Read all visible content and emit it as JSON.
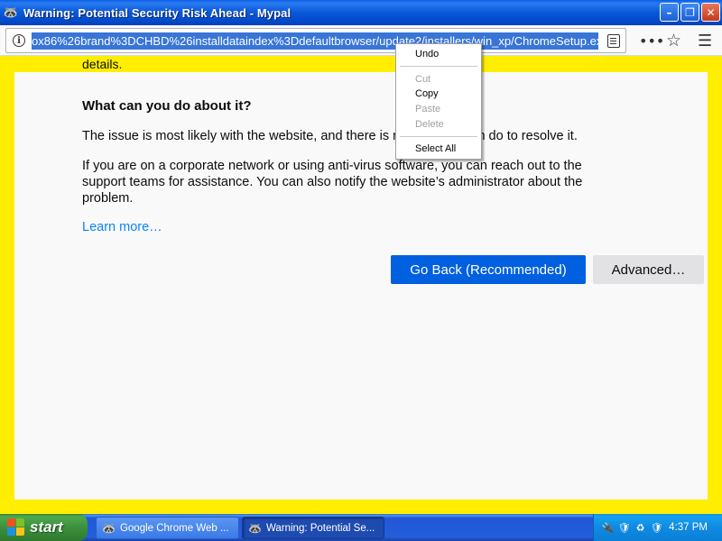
{
  "window": {
    "title": "Warning: Potential Security Risk Ahead - Mypal",
    "minimize_glyph": "–",
    "maximize_glyph": "❐",
    "close_glyph": "✕"
  },
  "toolbar": {
    "url": "ox86%26brand%3DCHBD%26installdataindex%3Ddefaultbrowser/update2/installers/win_xp/ChromeSetup.exe",
    "more_glyph": "•••",
    "star_glyph": "☆",
    "menu_glyph": "☰"
  },
  "page": {
    "top_peek": "details.",
    "heading": "What can you do about it?",
    "paragraph1": "The issue is most likely with the website, and there is nothing you can do to resolve it.",
    "paragraph2": "If you are on a corporate network or using anti-virus software, you can reach out to the support teams for assistance. You can also notify the website’s administrator about the problem.",
    "learn_more": "Learn more…",
    "go_back_button": "Go Back (Recommended)",
    "advanced_button": "Advanced…"
  },
  "context_menu": {
    "undo": "Undo",
    "cut": "Cut",
    "copy": "Copy",
    "paste": "Paste",
    "delete": "Delete",
    "select_all": "Select All"
  },
  "taskbar": {
    "start_label": "start",
    "tasks": [
      {
        "label": "Google Chrome Web ..."
      },
      {
        "label": "Warning: Potential Se..."
      }
    ],
    "clock": "4:37 PM"
  },
  "colors": {
    "accent": "#0060df",
    "link": "#0a84ff",
    "warning_border": "#ffee00"
  }
}
